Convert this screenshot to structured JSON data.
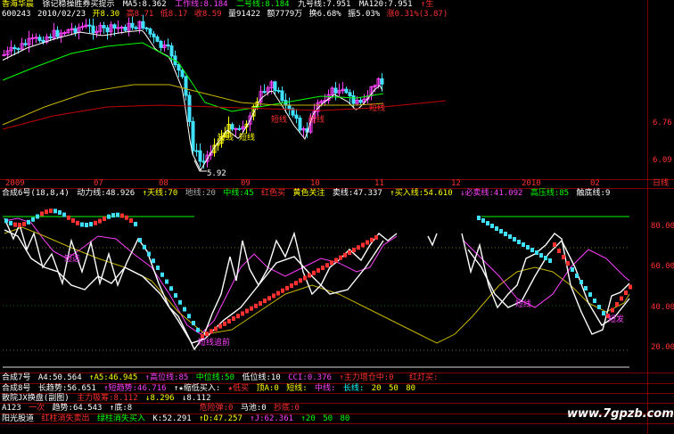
{
  "header": {
    "title": "香海华晨",
    "desc": "徐记稳操胜券买提示",
    "ma5": "MA5:8.362",
    "l_work": "工作线:8.184",
    "l_two": "二号线:8.184",
    "l_nine": "九号线:7.951",
    "ma120": "MA120:7.951",
    "l_gen": "↑生"
  },
  "info": {
    "code": "600243",
    "date": "2010/02/23",
    "open": "开8.30",
    "high": "高8.71",
    "low": "低8.17",
    "close": "收8.59",
    "vol": "量91422",
    "amt": "额7779万",
    "turn": "换6.68%",
    "amp": "振5.03%",
    "chg": "涨0.31%(3.87)"
  },
  "colors": {
    "up": "#ff3030",
    "down": "#40e0ff",
    "magenta": "#ff40ff",
    "yellow": "#ffff00",
    "green": "#00ff00",
    "white": "#ffffff",
    "olive": "#c8b400",
    "darkred": "#c00000",
    "cyan": "#00ffff"
  },
  "price_panel": {
    "yticks": [
      "6.76",
      "6.09"
    ],
    "low_label": "5.92",
    "annotations": [
      "短线",
      "短线",
      "短线",
      "短线",
      "短线"
    ]
  },
  "time_axis": {
    "labels": [
      "2009",
      "07",
      "08",
      "09",
      "10",
      "11",
      "12",
      "2010",
      "02"
    ],
    "right": "日线"
  },
  "osc_header": {
    "name": "合成6号(18,8,4)",
    "power": "动力线:48.926",
    "sky": "↑天线:70",
    "earth": "地线:20",
    "mid": "中线:45",
    "redbuy": "红色买",
    "yellow": "黄色关注",
    "sell": "卖线:47.337",
    "buy": "↑买入线:54.610",
    "must_sell": "↓必卖线:41.092",
    "high_press": "高压线:85",
    "bottom": "触底线:9"
  },
  "osc_panel": {
    "yticks": [
      "80.00",
      "60.00",
      "40.00",
      "20.00"
    ],
    "annotations": [
      "短选",
      "短线追前",
      "短线",
      "短发"
    ]
  },
  "bottom_rows": {
    "r1": [
      "合成7号",
      "A4:50.564",
      "↑A5:46.945",
      "↑高位线:85",
      "中位线:50",
      "低位线:10",
      "CCI:0.376",
      "↑主力增仓中:0",
      "红灯买:"
    ],
    "r2": [
      "合成8号",
      "长趋势:56.651",
      "↑短趋势:46.716",
      "↑★缩低买入:",
      "★低买",
      "顶A:0",
      "短线:",
      "中线:",
      "长线:",
      "20",
      "50",
      "80"
    ],
    "r3": [
      "散院JX换盘(副图)",
      "主力吸筹:8.112",
      "↓8.296",
      "↓8.112"
    ],
    "r4": [
      "A123",
      "一次",
      "趋势:64.543",
      "↑底:8",
      "",
      "",
      "危险弹:0",
      "马池:0",
      "抄底:0"
    ],
    "r5": [
      "阳光股道",
      "红柱消失卖出",
      "绿柱消失买入",
      "K:52.291",
      "↑D:47.257",
      "↑J:62.361",
      "↑20",
      "50",
      "80"
    ]
  },
  "watermark": "www.7gpzb.com"
}
